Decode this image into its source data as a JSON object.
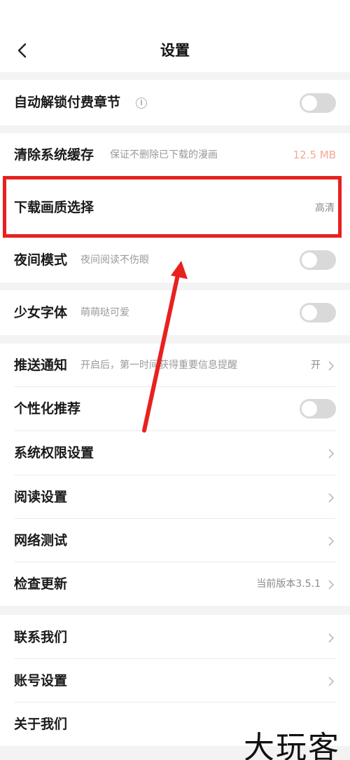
{
  "header": {
    "title": "设置",
    "back_icon": "chevron-left-icon"
  },
  "rows": {
    "auto_unlock": {
      "label": "自动解锁付费章节",
      "info_icon": "info-icon",
      "toggle_on": false
    },
    "clear_cache": {
      "label": "清除系统缓存",
      "sub": "保证不删除已下载的漫画",
      "value": "12.5 MB"
    },
    "download_quality": {
      "label": "下载画质选择",
      "value": "高清"
    },
    "night_mode": {
      "label": "夜间模式",
      "sub": "夜间阅读不伤眼",
      "toggle_on": false
    },
    "girl_font": {
      "label": "少女字体",
      "sub": "萌萌哒可爱",
      "toggle_on": false
    },
    "push": {
      "label": "推送通知",
      "sub": "开启后，第一时间获得重要信息提醒",
      "value": "开"
    },
    "personal_rec": {
      "label": "个性化推荐",
      "toggle_on": false
    },
    "permissions": {
      "label": "系统权限设置"
    },
    "reading": {
      "label": "阅读设置"
    },
    "network": {
      "label": "网络测试"
    },
    "update": {
      "label": "检查更新",
      "value": "当前版本3.5.1"
    },
    "contact": {
      "label": "联系我们"
    },
    "account": {
      "label": "账号设置"
    },
    "about": {
      "label": "关于我们"
    }
  },
  "colors": {
    "highlight": "#e8211e",
    "cache_value": "#f2a996",
    "toggle_off": "#d9d9d9"
  },
  "watermark": "大玩客"
}
